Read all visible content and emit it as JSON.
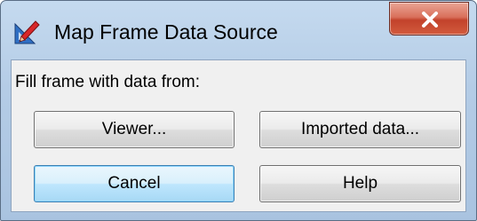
{
  "window": {
    "title": "Map Frame Data Source",
    "app_icon": "pencil-ruler-icon",
    "close_icon": "close-icon"
  },
  "dialog": {
    "prompt": "Fill frame with data from:",
    "buttons": {
      "viewer": "Viewer...",
      "imported": "Imported data...",
      "cancel": "Cancel",
      "help": "Help"
    },
    "default_button": "cancel"
  },
  "colors": {
    "close_button": "#c2422b",
    "default_button_border": "#3c7fb1"
  }
}
